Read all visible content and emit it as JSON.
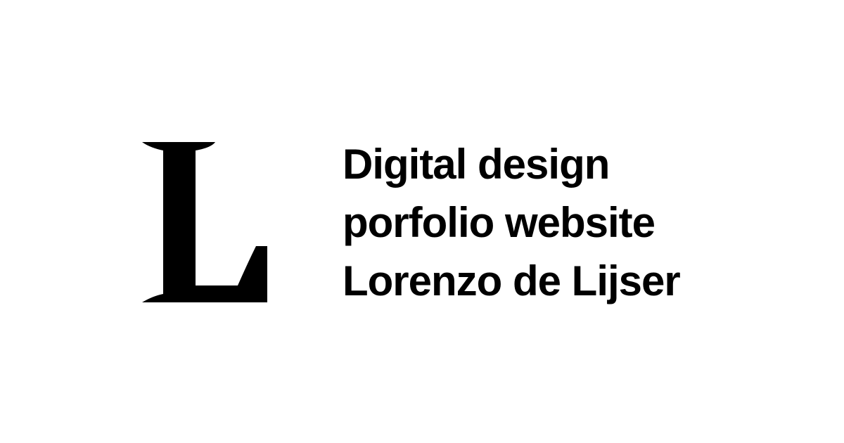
{
  "brand": {
    "logo_letter": "L",
    "logo_icon": "serif-letter-l-logo",
    "color": "#000000"
  },
  "tagline": {
    "lines": [
      "Digital design",
      "porfolio website",
      "Lorenzo de Lijser"
    ]
  },
  "colors": {
    "background": "#ffffff",
    "text": "#000000"
  }
}
